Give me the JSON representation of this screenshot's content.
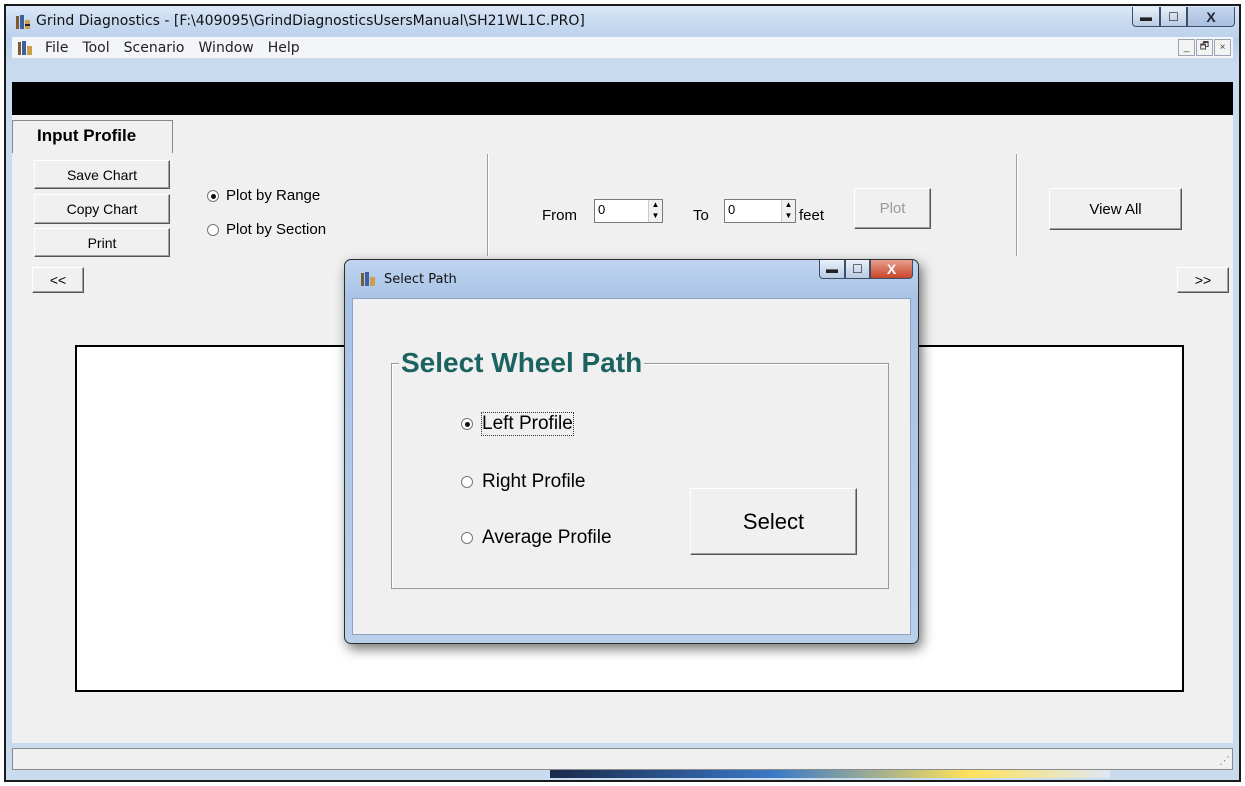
{
  "window": {
    "title": "Grind Diagnostics - [F:\\409095\\GrindDiagnosticsUsersManual\\SH21WL1C.PRO]",
    "app_icon": "app-logo-icon",
    "controls": [
      "minimize-icon",
      "maximize-icon",
      "close-icon"
    ]
  },
  "menubar": {
    "items": [
      "File",
      "Tool",
      "Scenario",
      "Window",
      "Help"
    ],
    "mdi_controls": [
      "_",
      "🗗",
      "×"
    ]
  },
  "tabs": [
    {
      "label": "Input Profile",
      "selected": true
    }
  ],
  "toolbar": {
    "buttons": {
      "save_chart": "Save Chart",
      "copy_chart": "Copy Chart",
      "print": "Print"
    },
    "plot_mode": {
      "options": [
        "Plot by Range",
        "Plot by Section"
      ],
      "selected": "Plot by Range"
    },
    "range": {
      "from_label": "From",
      "from_value": "0",
      "to_label": "To",
      "to_value": "0",
      "unit": "feet",
      "plot_label": "Plot"
    },
    "view_all_label": "View All"
  },
  "nav": {
    "prev": "<<",
    "next": ">>"
  },
  "dialog": {
    "title": "Select Path",
    "group_title": "Select Wheel Path",
    "options": [
      "Left Profile",
      "Right Profile",
      "Average Profile"
    ],
    "selected": "Left Profile",
    "select_button": "Select"
  },
  "colors": {
    "group_title": "#1b6360",
    "title_bar": "#c6d9f0",
    "client_bg": "#f0f0f0"
  }
}
